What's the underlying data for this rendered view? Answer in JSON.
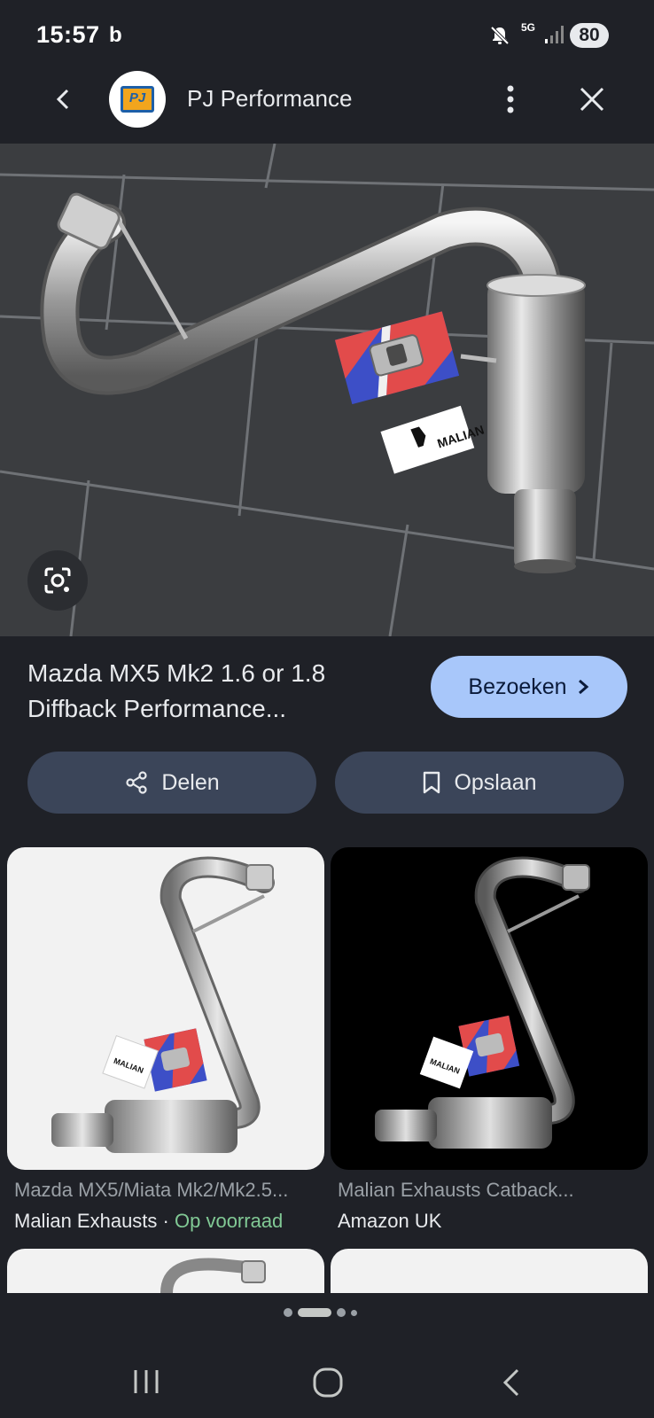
{
  "status": {
    "time": "15:57",
    "carrier_icon": "b",
    "network": "5G",
    "battery": "80"
  },
  "header": {
    "logo_text": "PJ",
    "site_name": "PJ Performance"
  },
  "result": {
    "title": "Mazda MX5 Mk2 1.6 or 1.8 Diffback Performance...",
    "visit_label": "Bezoeken",
    "share_label": "Delen",
    "save_label": "Opslaan"
  },
  "related": [
    {
      "title": "Mazda MX5/Miata Mk2/Mk2.5...",
      "source": "Malian Exhausts",
      "separator": "·",
      "stock": "Op voorraad",
      "tag_text": "MALIAN"
    },
    {
      "title": "Malian Exhausts Catback...",
      "source": "Amazon UK",
      "tag_text": "MALIAN"
    }
  ],
  "hero_tag_text": "MALIAN",
  "icons": {
    "back": "chevron-left-icon",
    "more": "more-vertical-icon",
    "close": "close-icon",
    "lens": "google-lens-icon",
    "share": "share-icon",
    "save": "bookmark-icon",
    "visit": "chevron-right-icon"
  },
  "colors": {
    "background": "#1f2127",
    "visit_button": "#a8c7fa",
    "action_button": "#3b4559",
    "in_stock": "#81c995"
  },
  "pagination": {
    "count": 4,
    "active": 1
  }
}
